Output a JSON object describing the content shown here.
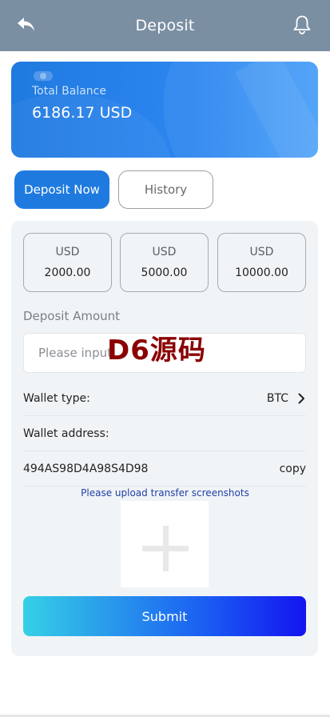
{
  "header": {
    "title": "Deposit",
    "back_icon": "back-arrow-icon",
    "bell_icon": "bell-icon"
  },
  "balance": {
    "label": "Total Balance",
    "amount": "6186.17 USD",
    "eye_icon": "eye-toggle-icon"
  },
  "tabs": [
    {
      "label": "Deposit Now",
      "active": true
    },
    {
      "label": "History",
      "active": false
    }
  ],
  "amount_options": [
    {
      "currency": "USD",
      "value": "2000.00"
    },
    {
      "currency": "USD",
      "value": "5000.00"
    },
    {
      "currency": "USD",
      "value": "10000.00"
    }
  ],
  "deposit_amount": {
    "label": "Deposit Amount",
    "placeholder": "Please input",
    "value": ""
  },
  "wallet": {
    "type_label": "Wallet type:",
    "type_value": "BTC",
    "address_label": "Wallet address:",
    "address_value": "494AS98D4A98S4D98",
    "copy_label": "copy"
  },
  "upload": {
    "hint": "Please upload transfer screenshots",
    "icon": "plus-icon"
  },
  "submit_label": "Submit",
  "watermark": "D6源码",
  "colors": {
    "header_bg": "#7b8fa3",
    "accent": "#1f7ae0",
    "panel_bg": "#f1f4f7",
    "hint_text": "#1f3fa8",
    "submit_start": "#36d0e6",
    "submit_end": "#1414f0",
    "watermark": "#8b0000"
  }
}
